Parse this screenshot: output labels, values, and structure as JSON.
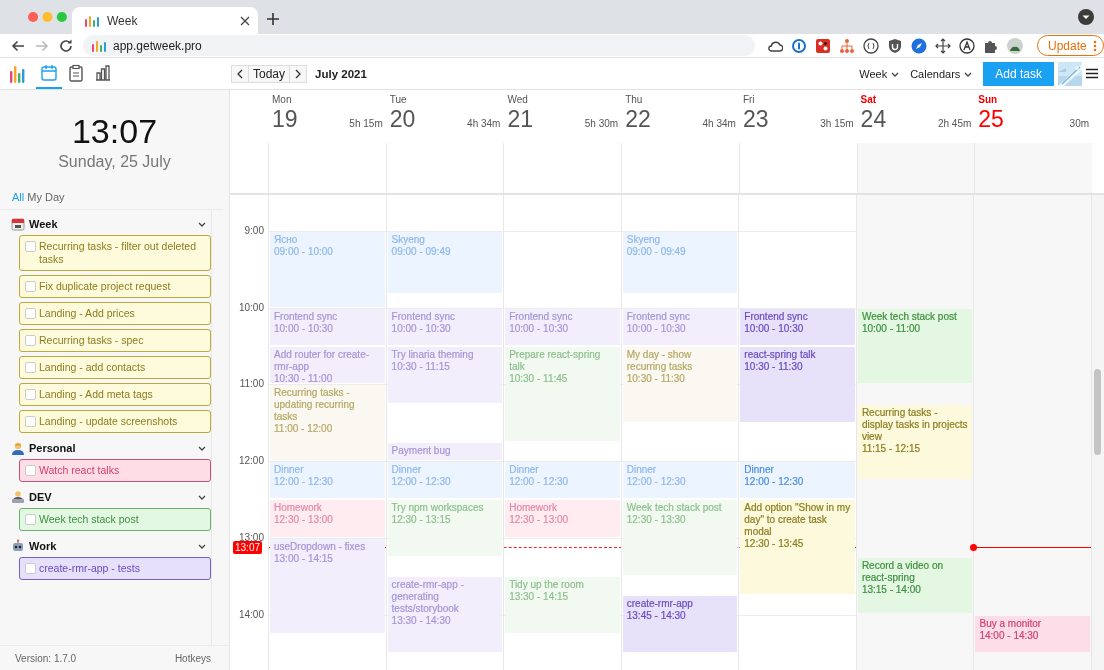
{
  "browser": {
    "tab_title": "Week",
    "url": "app.getweek.pro",
    "update_label": "Update"
  },
  "toolbar": {
    "nav": [
      {
        "kind": "calendar",
        "selected": true
      },
      {
        "kind": "tasks",
        "selected": false
      },
      {
        "kind": "stats",
        "selected": false
      }
    ],
    "today": "Today",
    "month": "July 2021",
    "view": "Week",
    "calendars": "Calendars",
    "add_task": "Add task"
  },
  "sidebar": {
    "clock": "13:07",
    "date": "Sunday, 25 July",
    "filters": [
      {
        "label": "All",
        "selected": true
      },
      {
        "label": "My Day",
        "selected": false
      }
    ],
    "groups": [
      {
        "name": "Week",
        "expanded": true,
        "color": "#8b7d1e",
        "tasks": [
          {
            "title": "Recurring tasks - filter out deleted tasks",
            "checked": false
          },
          {
            "title": "Fix duplicate project request",
            "checked": false
          },
          {
            "title": "Landing - Add prices",
            "checked": false
          },
          {
            "title": "Recurring tasks - spec",
            "checked": false
          },
          {
            "title": "Landing - add contacts",
            "checked": false
          },
          {
            "title": "Landing - Add meta tags",
            "checked": false
          },
          {
            "title": "Landing - update screenshots",
            "checked": false
          }
        ]
      },
      {
        "name": "Personal",
        "expanded": true,
        "color": "#d23f6e",
        "tasks": [
          {
            "title": "Watch react talks",
            "checked": false
          }
        ]
      },
      {
        "name": "DEV",
        "expanded": true,
        "color": "#3f8f3f",
        "tasks": [
          {
            "title": "Week tech stack post",
            "checked": false
          }
        ]
      },
      {
        "name": "Work",
        "expanded": true,
        "color": "#6a4bc0",
        "tasks": [
          {
            "title": "create-rmr-app - tests",
            "checked": false
          }
        ]
      }
    ],
    "version": "Version: 1.7.0",
    "hotkeys": "Hotkeys"
  },
  "calendar": {
    "hours": [
      "9:00",
      "10:00",
      "11:00",
      "12:00",
      "13:00",
      "14:00"
    ],
    "now": "13:07",
    "days": [
      {
        "name": "Mon",
        "date": "19",
        "total": "5h 15m",
        "weekend": false,
        "today": false,
        "events": [
          {
            "title": "Ясно",
            "time": "09:00 - 10:00",
            "color": "#8fb8ea"
          },
          {
            "title": "Frontend sync",
            "time": "10:00 - 10:30",
            "color": "#a595d6"
          },
          {
            "title": "Add router for create-rmr-app",
            "time": "10:30 - 11:00",
            "color": "#a595d6"
          },
          {
            "title": "Recurring tasks - updating recurring tasks",
            "time": "11:00 - 12:00",
            "color": "#b5a866"
          },
          {
            "title": "Dinner",
            "time": "12:00 - 12:30",
            "color": "#8fb8ea"
          },
          {
            "title": "Homework",
            "time": "12:30 - 13:00",
            "color": "#e38aa5"
          },
          {
            "title": "useDropdown - fixes",
            "time": "13:00 - 14:15",
            "color": "#a595d6"
          }
        ]
      },
      {
        "name": "Tue",
        "date": "20",
        "total": "4h 34m",
        "weekend": false,
        "today": false,
        "events": [
          {
            "title": "Skyeng",
            "time": "09:00 - 09:49",
            "color": "#8fb8ea"
          },
          {
            "title": "Frontend sync",
            "time": "10:00 - 10:30",
            "color": "#a595d6"
          },
          {
            "title": "Try linaria theming",
            "time": "10:30 - 11:15",
            "color": "#a595d6"
          },
          {
            "title": "Payment bug",
            "color": "#a595d6"
          },
          {
            "title": "Dinner",
            "time": "12:00 - 12:30",
            "color": "#8fb8ea"
          },
          {
            "title": "Try npm workspaces",
            "time": "12:30 - 13:15",
            "color": "#8dbf8d"
          },
          {
            "title": "create-rmr-app - generating tests/storybook",
            "time": "13:30 - 14:30",
            "color": "#a595d6"
          }
        ]
      },
      {
        "name": "Wed",
        "date": "21",
        "total": "5h 30m",
        "weekend": false,
        "today": false,
        "events": [
          {
            "title": "Frontend sync",
            "time": "10:00 - 10:30",
            "color": "#a595d6"
          },
          {
            "title": "Prepare react-spring talk",
            "time": "10:30 - 11:45",
            "color": "#8dbf8d"
          },
          {
            "title": "Dinner",
            "time": "12:00 - 12:30",
            "color": "#8fb8ea"
          },
          {
            "title": "Homework",
            "time": "12:30 - 13:00",
            "color": "#e38aa5"
          },
          {
            "title": "Tidy up the room",
            "time": "13:30 - 14:15",
            "color": "#8dbf8d"
          }
        ]
      },
      {
        "name": "Thu",
        "date": "22",
        "total": "4h 34m",
        "weekend": false,
        "today": false,
        "events": [
          {
            "title": "Skyeng",
            "time": "09:00 - 09:49",
            "color": "#8fb8ea"
          },
          {
            "title": "Frontend sync",
            "time": "10:00 - 10:30",
            "color": "#a595d6"
          },
          {
            "title": "My day - show recurring tasks",
            "time": "10:30 - 11:30",
            "color": "#b5a866"
          },
          {
            "title": "Dinner",
            "time": "12:00 - 12:30",
            "color": "#8fb8ea"
          },
          {
            "title": "Week tech stack post",
            "time": "12:30 - 13:30",
            "color": "#8dbf8d"
          },
          {
            "title": "create-rmr-app",
            "time": "13:45 - 14:30",
            "color": "#6a4bc0"
          }
        ]
      },
      {
        "name": "Fri",
        "date": "23",
        "total": "3h 15m",
        "weekend": false,
        "today": false,
        "events": [
          {
            "title": "Frontend sync",
            "time": "10:00 - 10:30",
            "color": "#6a4bc0"
          },
          {
            "title": "react-spring talk",
            "time": "10:30 - 11:30",
            "color": "#6a4bc0"
          },
          {
            "title": "Dinner",
            "time": "12:00 - 12:30",
            "color": "#4a90e2"
          },
          {
            "title": "Add option \"Show in my day\" to create task modal",
            "time": "12:30 - 13:45",
            "color": "#8b7d1e"
          }
        ]
      },
      {
        "name": "Sat",
        "date": "24",
        "total": "2h 45m",
        "weekend": true,
        "today": false,
        "events": [
          {
            "title": "Week tech stack post",
            "time": "10:00 - 11:00",
            "color": "#3f8f3f"
          },
          {
            "title": "Recurring tasks - display tasks in projects view",
            "time": "11:15 - 12:15",
            "color": "#8b7d1e"
          },
          {
            "title": "Record a video on react-spring",
            "time": "13:15 - 14:00",
            "color": "#3f8f3f"
          }
        ]
      },
      {
        "name": "Sun",
        "date": "25",
        "total": "30m",
        "weekend": true,
        "today": true,
        "events": [
          {
            "title": "Buy a monitor",
            "time": "14:00 - 14:30",
            "color": "#d23f6e"
          }
        ]
      }
    ]
  }
}
